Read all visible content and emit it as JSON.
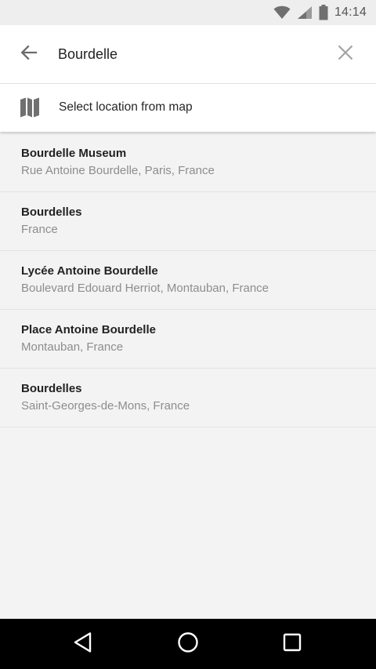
{
  "status_bar": {
    "time": "14:14",
    "icons": [
      "wifi-icon",
      "cell-signal-icon",
      "battery-icon"
    ]
  },
  "search": {
    "value": "Bourdelle",
    "back_icon": "arrow-left-icon",
    "clear_icon": "close-icon"
  },
  "map_option": {
    "icon": "map-icon",
    "label": "Select location from map"
  },
  "results": [
    {
      "title": "Bourdelle Museum",
      "subtitle": "Rue Antoine Bourdelle, Paris, France"
    },
    {
      "title": "Bourdelles",
      "subtitle": "France"
    },
    {
      "title": "Lycée Antoine Bourdelle",
      "subtitle": "Boulevard Edouard Herriot, Montauban, France"
    },
    {
      "title": "Place Antoine Bourdelle",
      "subtitle": "Montauban, France"
    },
    {
      "title": "Bourdelles",
      "subtitle": "Saint-Georges-de-Mons, France"
    }
  ],
  "nav_bar": {
    "buttons": [
      "nav-back-icon",
      "nav-home-icon",
      "nav-recents-icon"
    ]
  }
}
